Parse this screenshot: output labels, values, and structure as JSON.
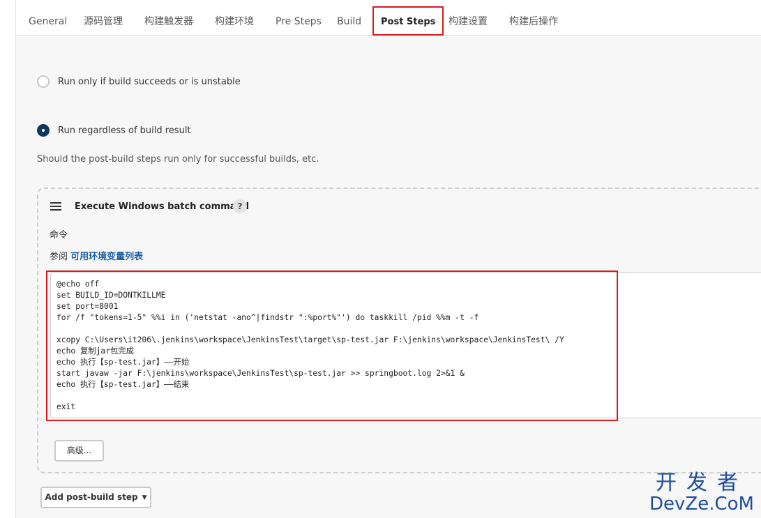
{
  "tabs": [
    {
      "label": "General"
    },
    {
      "label": "源码管理"
    },
    {
      "label": "构建触发器"
    },
    {
      "label": "构建环境"
    },
    {
      "label": "Pre Steps"
    },
    {
      "label": "Build"
    },
    {
      "label": "Post Steps"
    },
    {
      "label": "构建设置"
    },
    {
      "label": "构建后操作"
    }
  ],
  "active_tab": "Post Steps",
  "radio_options": [
    {
      "label": "Run only if build succeeds",
      "checked": false
    },
    {
      "label": "Run only if build succeeds or is unstable",
      "checked": false
    },
    {
      "label": "Run regardless of build result",
      "checked": true
    }
  ],
  "help_text": "Should the post-build steps run only for successful builds, etc.",
  "step": {
    "title": "Execute Windows batch command",
    "help_icon": "?",
    "field_label": "命令",
    "see_also_prefix": "参阅",
    "see_also_link": "可用环境变量列表",
    "command": "@echo off\nset BUILD_ID=DONTKILLME\nset port=8001\nfor /f \"tokens=1-5\" %%i in ('netstat -ano^|findstr \":%port%\"') do taskkill /pid %%m -t -f\n\nxcopy C:\\Users\\it206\\.jenkins\\workspace\\JenkinsTest\\target\\sp-test.jar F:\\jenkins\\workspace\\JenkinsTest\\ /Y\necho 复制jar包完成\necho 执行【sp-test.jar】——开始\nstart javaw -jar F:\\jenkins\\workspace\\JenkinsTest\\sp-test.jar >> springboot.log 2>&1 &\necho 执行【sp-test.jar】——结束\n\nexit",
    "advanced_button": "高级..."
  },
  "add_step_button": "Add post-build step",
  "watermark": {
    "top": "开发者",
    "bottom": "DevZe.CoM"
  },
  "colors": {
    "highlight": "#d9191f",
    "radio_checked": "#10385f",
    "link": "#1a5fa8"
  }
}
